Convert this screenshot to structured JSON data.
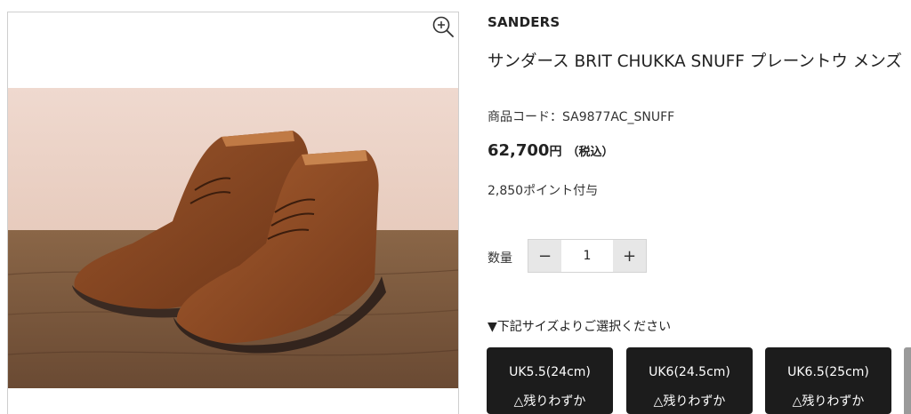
{
  "product": {
    "brand": "SANDERS",
    "title": "サンダース BRIT CHUKKA SNUFF プレーントウ メンズ",
    "code": "商品コード：SA9877AC_SNUFF",
    "price_number": "62,700",
    "price_unit": "円",
    "price_tax": "（税込）",
    "points": "2,850ポイント付与"
  },
  "quantity": {
    "label": "数量",
    "minus": "−",
    "value": "1",
    "plus": "+"
  },
  "sizes": {
    "heading": "▼下記サイズよりご選択ください",
    "options": [
      {
        "size": "UK5.5(24cm)",
        "stock": "△残りわずか"
      },
      {
        "size": "UK6(24.5cm)",
        "stock": "△残りわずか"
      },
      {
        "size": "UK6.5(25cm)",
        "stock": "△残りわずか"
      }
    ]
  },
  "icons": {
    "zoom": "zoom-in-icon"
  },
  "colors": {
    "size_button_bg": "#1c1c1c",
    "stepper_button_bg": "#e7e7e7",
    "suede_brown": "#7a3f1e"
  }
}
